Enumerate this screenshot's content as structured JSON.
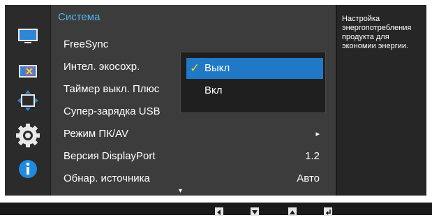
{
  "menu": {
    "title": "Система",
    "items": [
      {
        "label": "FreeSync",
        "value": ""
      },
      {
        "label": "Интел. экосохр.",
        "value": ""
      },
      {
        "label": "Таймер выкл. Плюс",
        "value": ""
      },
      {
        "label": "Супер-зарядка USB",
        "value": ""
      },
      {
        "label": "Режим ПК/AV",
        "value": "▸"
      },
      {
        "label": "Версия DisplayPort",
        "value": "1.2"
      },
      {
        "label": "Обнар. источника",
        "value": "Авто"
      }
    ],
    "scroll_down_glyph": "▾"
  },
  "submenu": {
    "options": [
      {
        "label": "Выкл",
        "selected": true,
        "check": "✓"
      },
      {
        "label": "Вкл",
        "selected": false,
        "check": ""
      }
    ]
  },
  "info": {
    "text": "Настройка энергопотребления продукта для экономии энергии."
  },
  "sidebar": {
    "icons": [
      "monitor-picture-icon",
      "screen-adjust-icon",
      "position-icon",
      "system-gear-icon",
      "info-icon"
    ]
  },
  "bottom_bar": {
    "buttons": [
      "left-arrow-icon",
      "down-arrow-icon",
      "up-arrow-icon",
      "enter-icon"
    ]
  },
  "colors": {
    "accent": "#1f79c7",
    "title": "#4fb4ea",
    "check": "#ffd21f"
  }
}
